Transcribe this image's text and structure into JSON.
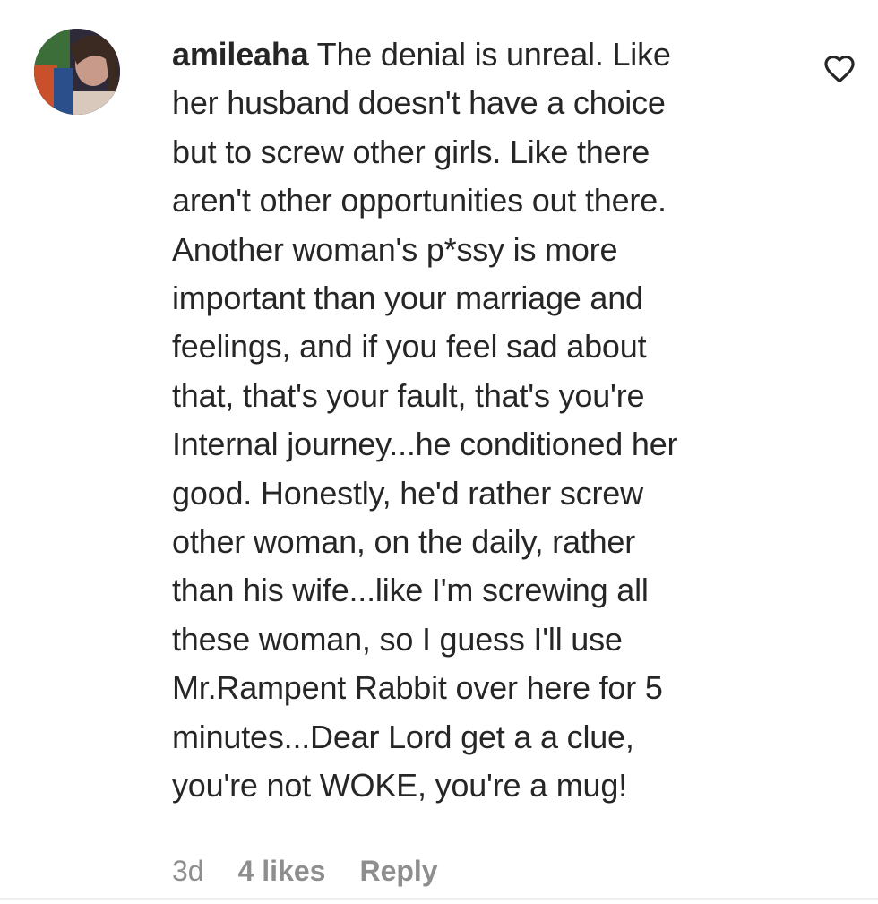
{
  "comment": {
    "username": "amileaha",
    "text": "The denial is unreal. Like\nher husband doesn't have a choice\nbut to screw other girls. Like there\naren't other opportunities out there.\nAnother woman's p*ssy is more\nimportant than your marriage and\nfeelings, and if you feel sad about\nthat, that's your fault, that's you're\nInternal journey...he conditioned her\ngood. Honestly, he'd rather screw\nother woman, on the daily, rather\nthan his wife...like I'm screwing all\nthese woman, so I guess I'll use\nMr.Rampent Rabbit over here for 5\nminutes...Dear Lord get a a clue,\nyou're not WOKE, you're a mug!",
    "timestamp": "3d",
    "likes": "4 likes",
    "reply_label": "Reply",
    "like_icon": "heart-outline-icon"
  },
  "colors": {
    "text": "#262626",
    "meta": "#8e8e8e",
    "divider": "#efefef"
  }
}
